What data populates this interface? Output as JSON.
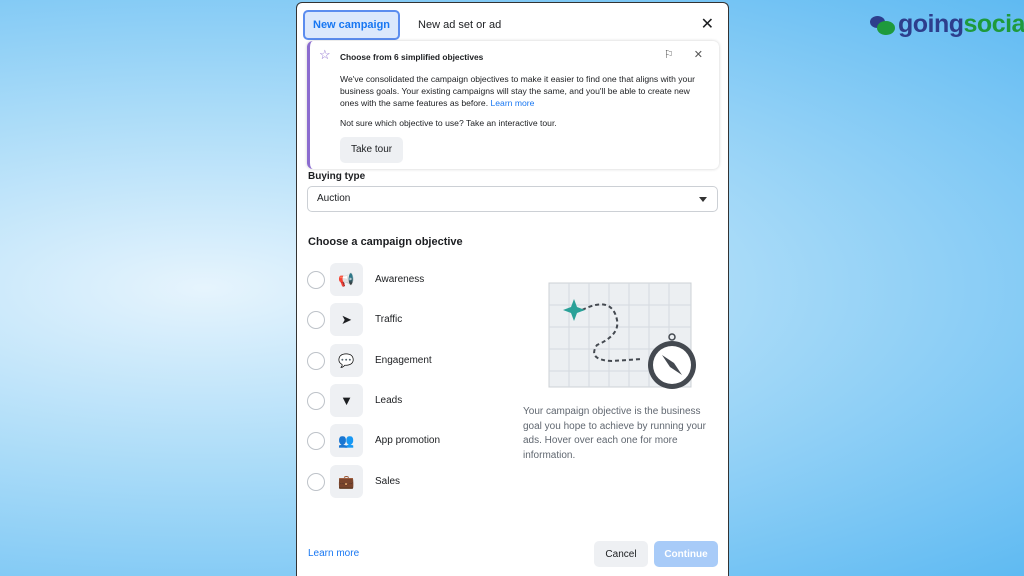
{
  "logo": {
    "part1": "going",
    "part2": "social",
    "colors": {
      "going": "#2d3e8c",
      "social": "#1e9a3c"
    }
  },
  "tabs": [
    {
      "label": "New campaign",
      "active": true
    },
    {
      "label": "New ad set or ad",
      "active": false
    }
  ],
  "notice": {
    "title": "Choose from 6 simplified objectives",
    "body": "We've consolidated the campaign objectives to make it easier to find one that aligns with your business goals. Your existing campaigns will stay the same, and you'll be able to create new ones with the same features as before.",
    "link": "Learn more",
    "tour_text": "Not sure which objective to use? Take an interactive tour.",
    "tour_button": "Take tour"
  },
  "buying_type": {
    "label": "Buying type",
    "value": "Auction"
  },
  "objectives": {
    "heading": "Choose a campaign objective",
    "items": [
      {
        "label": "Awareness",
        "icon": "megaphone-icon"
      },
      {
        "label": "Traffic",
        "icon": "cursor-icon"
      },
      {
        "label": "Engagement",
        "icon": "chat-bubbles-icon"
      },
      {
        "label": "Leads",
        "icon": "funnel-icon"
      },
      {
        "label": "App promotion",
        "icon": "people-icon"
      },
      {
        "label": "Sales",
        "icon": "briefcase-icon"
      }
    ],
    "description": "Your campaign objective is the business goal you hope to achieve by running your ads. Hover over each one for more information."
  },
  "footer": {
    "learn_more": "Learn more",
    "cancel": "Cancel",
    "continue": "Continue"
  },
  "colors": {
    "accent": "#1877f2",
    "notice_border": "#8b6ccf",
    "continue_disabled": "#a8cbf8"
  }
}
